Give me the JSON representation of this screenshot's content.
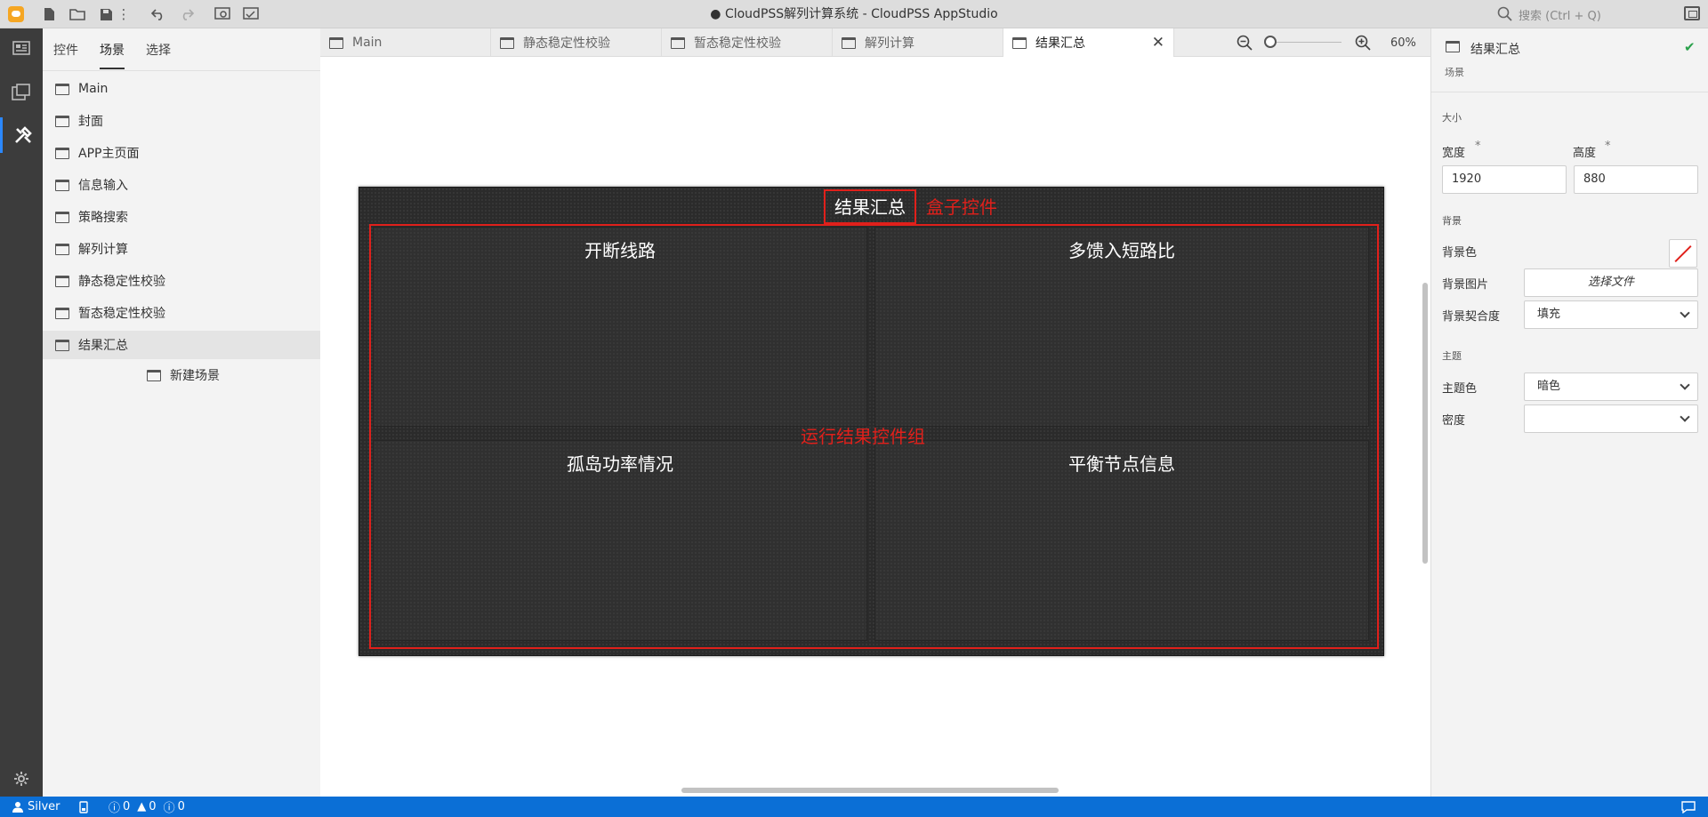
{
  "window": {
    "title": "● CloudPSS解列计算系统 - CloudPSS AppStudio",
    "search_placeholder": "搜索 (Ctrl + Q)"
  },
  "toolbar": {
    "icons": [
      "new-file-icon",
      "open-folder-icon",
      "save-icon",
      "more-icon",
      "undo-icon",
      "redo-icon",
      "preview-icon",
      "publish-icon"
    ]
  },
  "activity_bar": {
    "items": [
      "dashboard-icon",
      "layout-icon",
      "tools-icon"
    ],
    "active": "tools-icon",
    "settings": "gear-icon"
  },
  "left_panel": {
    "tabs": [
      "控件",
      "场景",
      "选择"
    ],
    "active_tab": "场景",
    "scenes": [
      "Main",
      "封面",
      "APP主页面",
      "信息输入",
      "策略搜索",
      "解列计算",
      "静态稳定性校验",
      "暂态稳定性校验",
      "结果汇总"
    ],
    "selected_scene": "结果汇总",
    "new_scene": "新建场景"
  },
  "editor_tabs": {
    "tabs": [
      "Main",
      "静态稳定性校验",
      "暂态稳定性校验",
      "解列计算",
      "结果汇总"
    ],
    "active": "结果汇总",
    "zoom": "60%"
  },
  "canvas": {
    "scene_title": "结果汇总",
    "box_annotation": "盒子控件",
    "group_annotation": "运行结果控件组",
    "panels": [
      "开断线路",
      "多馈入短路比",
      "孤岛功率情况",
      "平衡节点信息"
    ],
    "colors": {
      "annotation": "#e0201b",
      "scene_bg": "#2b2b2b"
    }
  },
  "properties": {
    "name": "结果汇总",
    "type": "场景",
    "size_section": "大小",
    "width_label": "宽度",
    "width_value": "1920",
    "height_label": "高度",
    "height_value": "880",
    "required_mark": "*",
    "background_section": "背景",
    "bg_color_label": "背景色",
    "bg_image_label": "背景图片",
    "bg_image_button": "选择文件",
    "bg_fit_label": "背景契合度",
    "bg_fit_value": "填充",
    "theme_section": "主题",
    "theme_color_label": "主题色",
    "theme_color_value": "暗色",
    "density_label": "密度",
    "density_value": ""
  },
  "status_bar": {
    "user": "Silver",
    "errors": "0",
    "warnings": "0",
    "infos": "0",
    "accent": "#0b6fd6"
  }
}
